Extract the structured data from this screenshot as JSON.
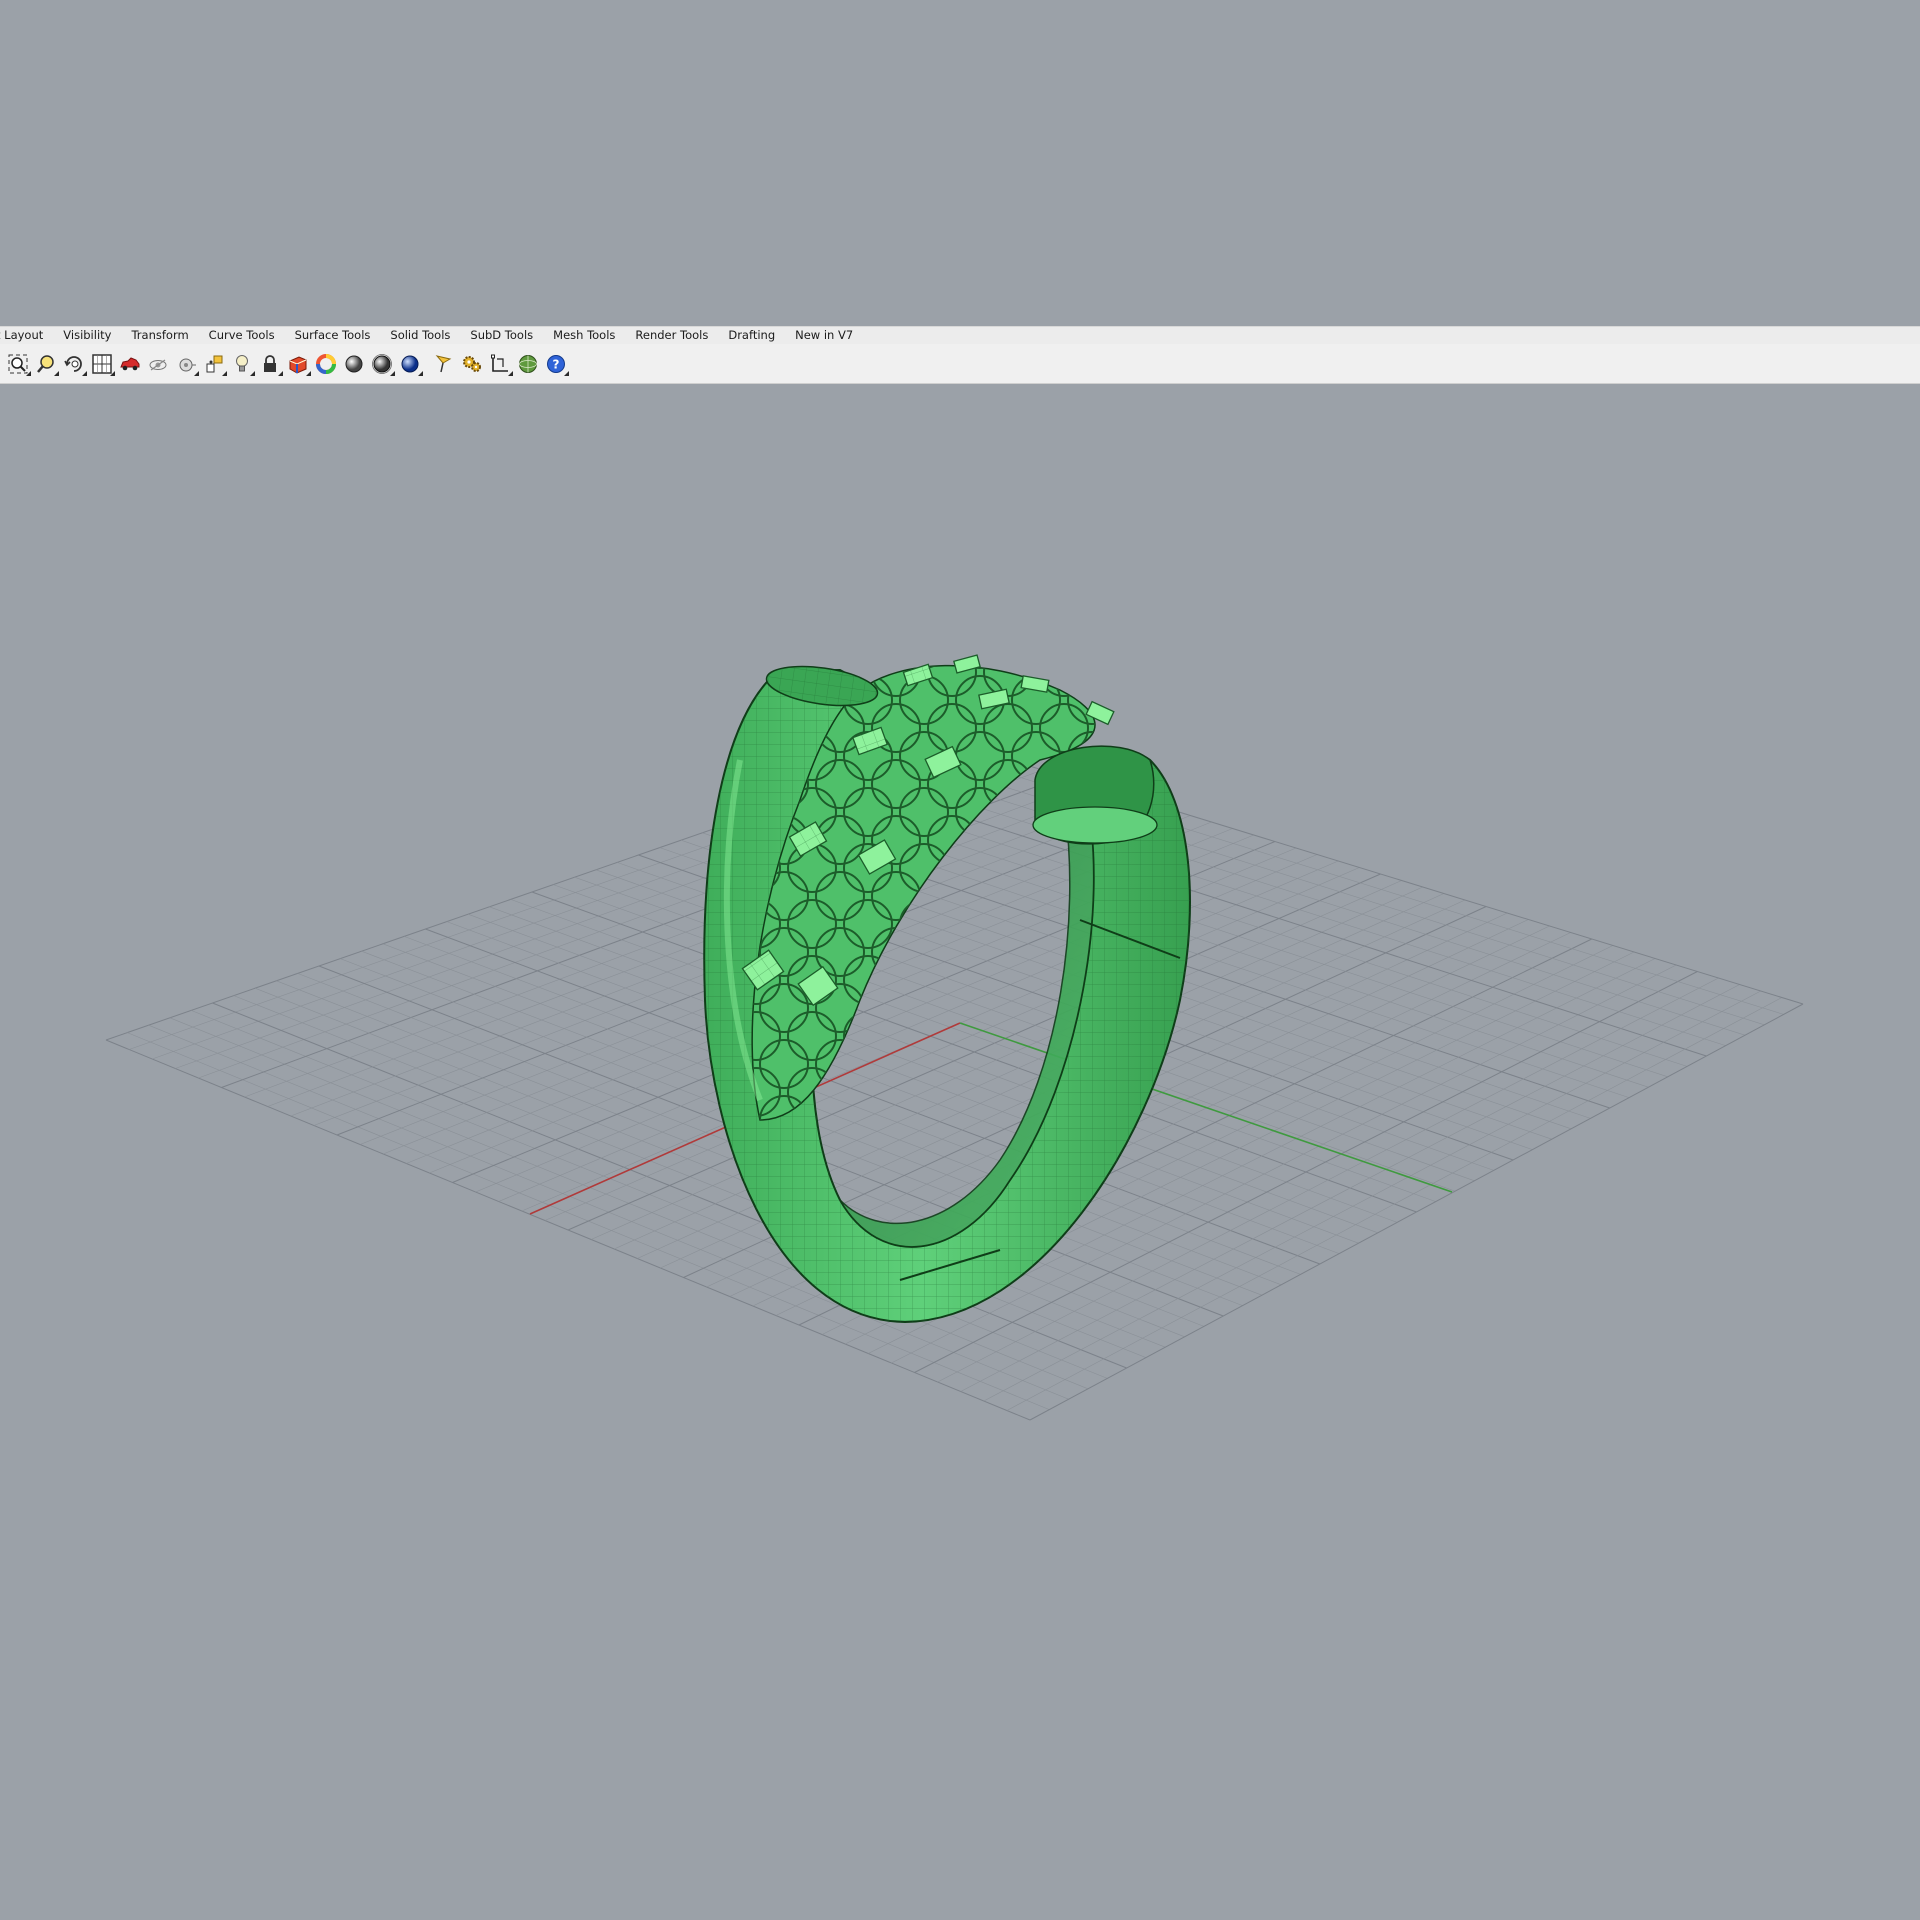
{
  "window": {
    "menu_tabs": [
      "t Layout",
      "Visibility",
      "Transform",
      "Curve Tools",
      "Surface Tools",
      "Solid Tools",
      "SubD Tools",
      "Mesh Tools",
      "Render Tools",
      "Drafting",
      "New in V7"
    ]
  },
  "toolbar": {
    "icons": [
      "zoom-extents-icon",
      "zoom-window-icon",
      "rotate-view-icon",
      "viewport-layout-icon",
      "car-icon",
      "eye-icon",
      "camera-icon",
      "point-object-icon",
      "light-bulb-icon",
      "lock-icon",
      "material-icon",
      "color-wheel-icon",
      "shaded-sphere-icon",
      "rendered-sphere-icon",
      "blue-sphere-icon",
      "pencil-icon",
      "gears-icon",
      "dimension-icon",
      "globe-icon",
      "help-icon"
    ]
  },
  "viewport": {
    "background_color": "#9ba1a8",
    "grid_color": "#8a9097",
    "x_axis_color": "#b03a3a",
    "y_axis_color": "#3f9a3f",
    "model_color": "#4dc066",
    "model_highlight_color": "#8ef29c",
    "model_name": "ring-model"
  }
}
